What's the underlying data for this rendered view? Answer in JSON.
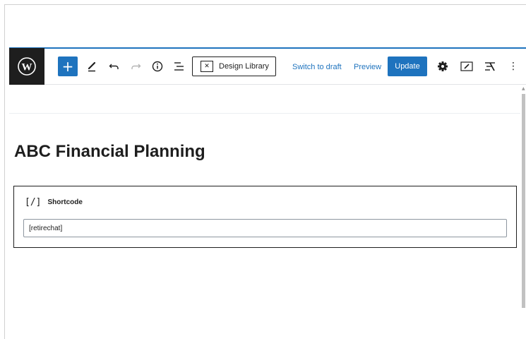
{
  "toolbar": {
    "add_icon": "plus-icon",
    "tools_icon": "pencil-icon",
    "undo_icon": "undo-icon",
    "redo_icon": "redo-icon",
    "info_icon": "info-icon",
    "outline_icon": "list-view-icon",
    "design_library_label": "Design Library",
    "switch_to_draft_label": "Switch to draft",
    "preview_label": "Preview",
    "update_label": "Update",
    "settings_icon": "gear-icon",
    "editor_icon": "editor-icon",
    "plugin_icon": "design-library-icon",
    "more_icon": "more-options-icon",
    "accent_color": "#1e73be"
  },
  "post": {
    "title": "ABC Financial Planning"
  },
  "block": {
    "type_label": "Shortcode",
    "type_icon": "shortcode-icon",
    "shortcode_value": "[retirechat]"
  }
}
